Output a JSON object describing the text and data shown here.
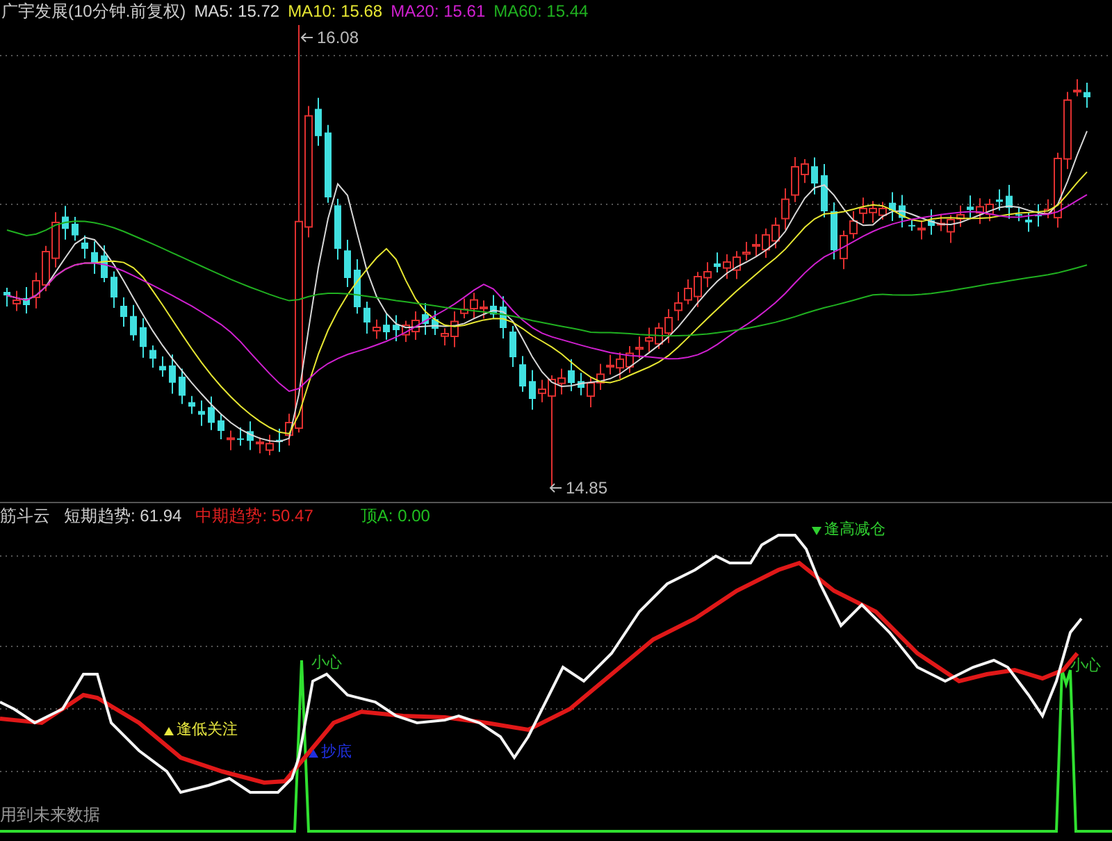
{
  "title": "广宇发展(10分钟.前复权)",
  "moving_averages": [
    {
      "label": "MA5: 15.72",
      "color": "#d8d8d8"
    },
    {
      "label": "MA10: 15.68",
      "color": "#e6e632"
    },
    {
      "label": "MA20: 15.61",
      "color": "#d020d0"
    },
    {
      "label": "MA60: 15.44",
      "color": "#20b020"
    }
  ],
  "price_marks": [
    {
      "text": "16.08",
      "kind": "high"
    },
    {
      "text": "14.85",
      "kind": "low"
    }
  ],
  "indicator": {
    "name": "筋斗云",
    "readings": [
      {
        "label": "短期趋势: 61.94",
        "color": "#d0d0d0"
      },
      {
        "label": "中期趋势: 50.47",
        "color": "#e02020"
      },
      {
        "label": "顶A: 0.00",
        "color": "#20c020"
      }
    ],
    "signals": [
      {
        "text": "逢高减仓",
        "kind": "sell"
      },
      {
        "text": "小心",
        "kind": "caution"
      },
      {
        "text": "抄底",
        "kind": "bottom"
      },
      {
        "text": "逢低关注",
        "kind": "buy"
      },
      {
        "text": "小心",
        "kind": "caution"
      }
    ],
    "notice": "用到未来数据"
  }
}
